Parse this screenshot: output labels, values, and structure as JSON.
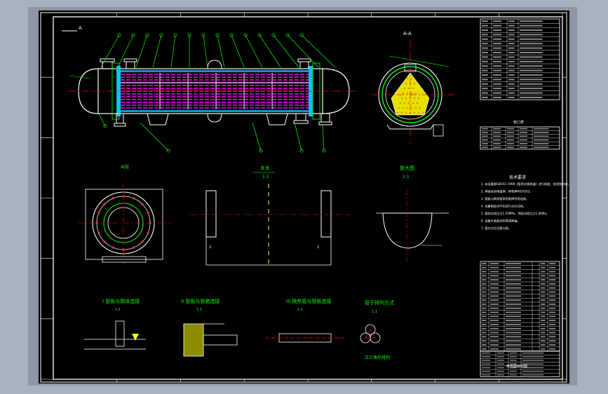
{
  "views": {
    "section_aa_label": "A-A",
    "view_a_label": "A向",
    "section_bb_label": "B-B",
    "scale_1_1": "1:1",
    "detail_label": "放大图",
    "ref_a": "A",
    "left_mark_2": "2",
    "right_mark_2": "2"
  },
  "details": {
    "d1_title": "I 管板与筒体连接",
    "d2_title": "II 管板与管箱连接",
    "d3_title": "III 换热管与管板连接",
    "d4_title": "管子排列方式",
    "d4_sub": "正三角形排列",
    "scale": "1:1"
  },
  "tables": {
    "nozzle_title": "管口表",
    "notes_title": "技术要求",
    "notes": [
      "1. 本设备按GB151-1999《管壳式换热器》进行制造、检验和验收。",
      "2. 焊接采用电弧焊，焊条牌号E4303。",
      "3. 管板与换热管采用胀焊并用连接。",
      "4. 设备制造完毕后进行水压试验。",
      "5. 管程试验压力1.25MPa，壳程试验压力1.0MPa。",
      "6. 设备外表面涂防锈漆两遍。",
      "7. 管口方位见管口表。"
    ],
    "title_block_name": "换热器装配图"
  },
  "colors": {
    "background": "#000000",
    "frame": "#ffffff",
    "lines": "#00ff00",
    "outline": "#ffffff",
    "tubes": "#ff00ff",
    "tube_bundle": "#ffff00",
    "center_lines": "#ff0000",
    "shell_fill": "#00c0ff"
  }
}
